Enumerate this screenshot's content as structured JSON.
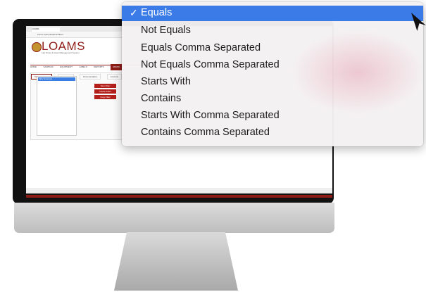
{
  "browser": {
    "tab_title": "LOAMS",
    "url": "loams.example/admin/filters"
  },
  "app": {
    "logo_text": "LOAMS",
    "tagline": "Lab Order & Asset Management System",
    "nav_items": [
      "HOME",
      "SAMPLES",
      "EQUIPMENT",
      "LABELS",
      "REPORTS",
      "ADMIN"
    ],
    "active_nav": 5,
    "subtabs": [
      "Manage Filters",
      "Test Sets",
      "Documentation",
      "Controls"
    ],
    "active_subtab": 0,
    "list_selected": "Filter Example",
    "buttons": [
      "New Filter",
      "Delete Filter",
      "Copy Filter"
    ]
  },
  "dropdown": {
    "selected_index": 0,
    "options": [
      "Equals",
      "Not Equals",
      "Equals Comma Separated",
      "Not Equals Comma Separated",
      "Starts With",
      "Contains",
      "Starts With Comma Separated",
      "Contains Comma Separated"
    ],
    "checkmark": "✓"
  },
  "colors": {
    "accent": "#8e1c16",
    "selection": "#3b7be8",
    "bezel": "#111111"
  }
}
